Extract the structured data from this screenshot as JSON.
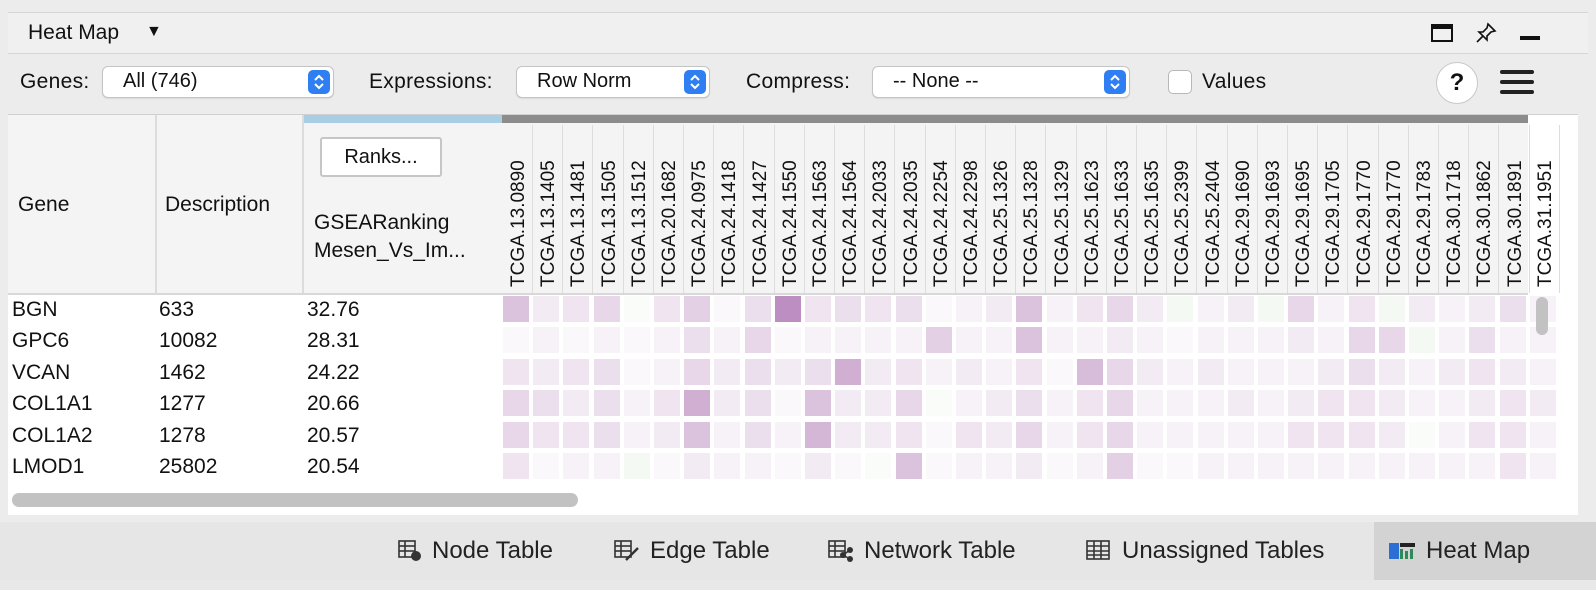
{
  "panel": {
    "title": "Heat Map",
    "caret": "▼"
  },
  "toolbar": {
    "genes_label": "Genes:",
    "genes_value": "All (746)",
    "expressions_label": "Expressions:",
    "expressions_value": "Row Norm",
    "compress_label": "Compress:",
    "compress_value": "-- None --",
    "values_label": "Values",
    "values_checked": false,
    "help_label": "?"
  },
  "table": {
    "headers": {
      "gene": "Gene",
      "description": "Description",
      "ranks_button": "Ranks...",
      "ranking_line1": "GSEARanking",
      "ranking_line2": "Mesen_Vs_Im..."
    },
    "samples": [
      "TCGA.13.0890",
      "TCGA.13.1405",
      "TCGA.13.1481",
      "TCGA.13.1505",
      "TCGA.13.1512",
      "TCGA.20.1682",
      "TCGA.24.0975",
      "TCGA.24.1418",
      "TCGA.24.1427",
      "TCGA.24.1550",
      "TCGA.24.1563",
      "TCGA.24.1564",
      "TCGA.24.2033",
      "TCGA.24.2035",
      "TCGA.24.2254",
      "TCGA.24.2298",
      "TCGA.25.1326",
      "TCGA.25.1328",
      "TCGA.25.1329",
      "TCGA.25.1623",
      "TCGA.25.1633",
      "TCGA.25.1635",
      "TCGA.25.2399",
      "TCGA.25.2404",
      "TCGA.29.1690",
      "TCGA.29.1693",
      "TCGA.29.1695",
      "TCGA.29.1705",
      "TCGA.29.1770",
      "TCGA.29.1770",
      "TCGA.29.1783",
      "TCGA.30.1718",
      "TCGA.30.1862",
      "TCGA.30.1891",
      "TCGA.31.1951"
    ],
    "rows": [
      {
        "gene": "BGN",
        "description": "633",
        "ranking": "32.76",
        "values": [
          0.45,
          0.15,
          0.2,
          0.3,
          -0.05,
          0.2,
          0.35,
          0.05,
          0.25,
          0.85,
          0.2,
          0.25,
          0.2,
          0.25,
          0.05,
          0.1,
          0.15,
          0.45,
          0.1,
          0.2,
          0.3,
          0.15,
          -0.1,
          0.1,
          0.15,
          -0.1,
          0.3,
          0.1,
          0.2,
          -0.1,
          0.15,
          0.1,
          0.15,
          0.25,
          0.1
        ]
      },
      {
        "gene": "GPC6",
        "description": "10082",
        "ranking": "28.31",
        "values": [
          0.05,
          0.1,
          0.05,
          0.1,
          0.05,
          0.1,
          0.25,
          0.1,
          0.3,
          0.05,
          0.1,
          0.1,
          0.1,
          0.1,
          0.35,
          0.1,
          0.1,
          0.45,
          0.1,
          0.1,
          0.15,
          0.1,
          0.05,
          0.1,
          0.1,
          0.1,
          0.15,
          0.1,
          0.3,
          0.3,
          -0.1,
          0.1,
          0.25,
          0.1,
          0.1
        ]
      },
      {
        "gene": "VCAN",
        "description": "1462",
        "ranking": "24.22",
        "values": [
          0.2,
          0.15,
          0.2,
          0.25,
          0.05,
          0.1,
          0.3,
          0.15,
          0.25,
          0.15,
          0.25,
          0.6,
          0.15,
          0.2,
          0.1,
          0.15,
          0.1,
          0.2,
          0.05,
          0.5,
          0.3,
          0.15,
          0.1,
          0.15,
          0.1,
          0.1,
          0.1,
          0.15,
          0.25,
          0.15,
          0.1,
          0.15,
          0.2,
          0.15,
          0.1
        ]
      },
      {
        "gene": "COL1A1",
        "description": "1277",
        "ranking": "20.66",
        "values": [
          0.3,
          0.25,
          0.15,
          0.25,
          0.1,
          0.2,
          0.6,
          0.15,
          0.25,
          0.05,
          0.45,
          0.15,
          0.15,
          0.3,
          -0.05,
          0.1,
          0.15,
          0.25,
          0.1,
          0.2,
          0.3,
          0.1,
          0.1,
          0.1,
          0.15,
          0.1,
          0.15,
          0.2,
          0.2,
          0.15,
          0.1,
          0.1,
          0.15,
          0.2,
          0.15
        ]
      },
      {
        "gene": "COL1A2",
        "description": "1278",
        "ranking": "20.57",
        "values": [
          0.3,
          0.2,
          0.2,
          0.25,
          0.1,
          0.15,
          0.45,
          0.1,
          0.25,
          0.1,
          0.55,
          0.15,
          0.15,
          0.2,
          0.05,
          0.2,
          0.15,
          0.3,
          0.1,
          0.2,
          0.3,
          0.1,
          0.1,
          0.1,
          0.1,
          0.1,
          0.2,
          0.2,
          0.2,
          0.15,
          -0.05,
          0.1,
          0.2,
          0.2,
          0.1
        ]
      },
      {
        "gene": "LMOD1",
        "description": "25802",
        "ranking": "20.54",
        "values": [
          0.2,
          0.05,
          0.1,
          0.1,
          -0.1,
          0.05,
          0.15,
          0.1,
          0.1,
          0.05,
          0.15,
          0.05,
          -0.05,
          0.45,
          0.05,
          0.1,
          0.1,
          0.15,
          0.05,
          0.1,
          0.35,
          0.05,
          0.05,
          0.1,
          0.1,
          0.1,
          0.1,
          0.1,
          0.1,
          0.1,
          0.1,
          0.1,
          0.1,
          0.2,
          0.1
        ]
      }
    ]
  },
  "tabs": [
    {
      "label": "Node Table",
      "icon": "node-table-icon"
    },
    {
      "label": "Edge Table",
      "icon": "edge-table-icon"
    },
    {
      "label": "Network Table",
      "icon": "network-table-icon"
    },
    {
      "label": "Unassigned Tables",
      "icon": "unassigned-tables-icon"
    },
    {
      "label": "Heat Map",
      "icon": "heat-map-icon",
      "active": true
    }
  ],
  "colors": {
    "positive": "#b07ab6",
    "negative": "#8fbf8f",
    "accent": "#2f7ff2"
  }
}
